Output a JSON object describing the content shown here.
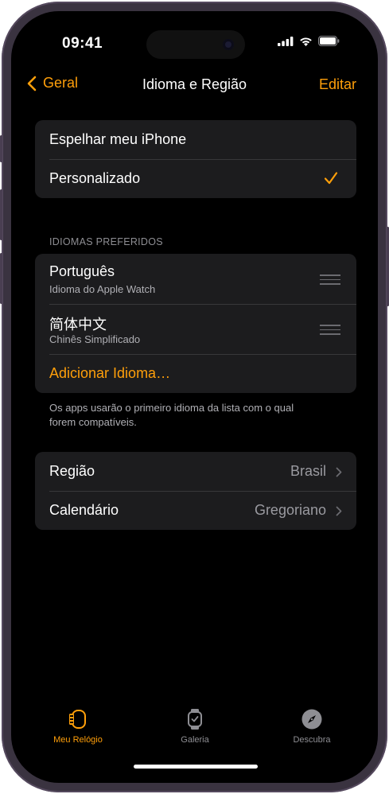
{
  "status_bar": {
    "time": "09:41"
  },
  "nav": {
    "back_label": "Geral",
    "title": "Idioma e Região",
    "edit_label": "Editar"
  },
  "mode_group": {
    "items": [
      {
        "label": "Espelhar meu iPhone",
        "selected": false
      },
      {
        "label": "Personalizado",
        "selected": true
      }
    ]
  },
  "preferred_languages": {
    "header": "IDIOMAS PREFERIDOS",
    "items": [
      {
        "name": "Português",
        "subtitle": "Idioma do Apple Watch"
      },
      {
        "name": "简体中文",
        "subtitle": "Chinês Simplificado"
      }
    ],
    "add_label": "Adicionar Idioma…",
    "footer": "Os apps usarão o primeiro idioma da lista com o qual forem compatíveis."
  },
  "region_group": {
    "items": [
      {
        "label": "Região",
        "value": "Brasil"
      },
      {
        "label": "Calendário",
        "value": "Gregoriano"
      }
    ]
  },
  "tab_bar": {
    "tabs": [
      {
        "label": "Meu Relógio",
        "icon": "watch-face-icon",
        "active": true
      },
      {
        "label": "Galeria",
        "icon": "watch-icon",
        "active": false
      },
      {
        "label": "Descubra",
        "icon": "compass-icon",
        "active": false
      }
    ]
  },
  "colors": {
    "accent": "#FF9F0A",
    "background": "#000000",
    "cell": "#1c1c1e",
    "secondary_text": "#8e8e93"
  }
}
